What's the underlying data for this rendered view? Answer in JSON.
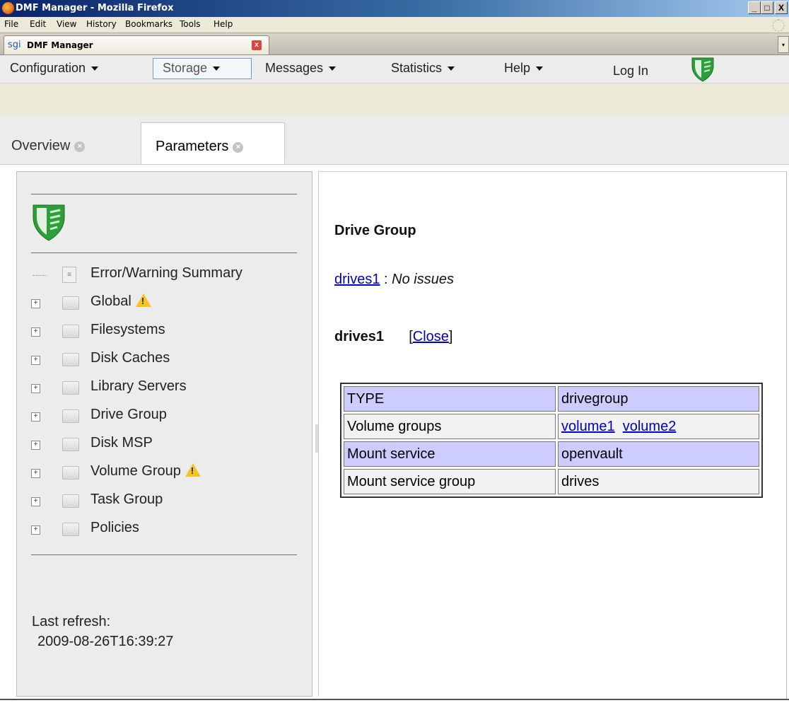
{
  "window": {
    "title": "DMF Manager - Mozilla Firefox",
    "buttons": [
      "_",
      "□",
      "X"
    ]
  },
  "browser_menu": [
    "File",
    "Edit",
    "View",
    "History",
    "Bookmarks",
    "Tools",
    "Help"
  ],
  "browser_tab": {
    "icon_text": "sgi",
    "title": "DMF Manager",
    "close_symbol": "x"
  },
  "app_nav": {
    "items": [
      "Configuration",
      "Storage",
      "Messages",
      "Statistics",
      "Help"
    ],
    "active": "Storage",
    "login": "Log In"
  },
  "content_tabs": [
    "Overview",
    "Parameters"
  ],
  "active_content_tab": "Parameters",
  "tree": {
    "items": [
      {
        "label": "Error/Warning Summary",
        "type": "doc",
        "warning": false
      },
      {
        "label": "Global",
        "type": "folder",
        "warning": true
      },
      {
        "label": "Filesystems",
        "type": "folder",
        "warning": false
      },
      {
        "label": "Disk Caches",
        "type": "folder",
        "warning": false
      },
      {
        "label": "Library Servers",
        "type": "folder",
        "warning": false
      },
      {
        "label": "Drive Group",
        "type": "folder",
        "warning": false
      },
      {
        "label": "Disk MSP",
        "type": "folder",
        "warning": false
      },
      {
        "label": "Volume Group",
        "type": "folder",
        "warning": true
      },
      {
        "label": "Task Group",
        "type": "folder",
        "warning": false
      },
      {
        "label": "Policies",
        "type": "folder",
        "warning": false
      }
    ],
    "expander": "+"
  },
  "refresh": {
    "label": "Last refresh:",
    "timestamp": "2009-08-26T16:39:27"
  },
  "main": {
    "heading": "Drive Group",
    "issue_link": "drives1",
    "issue_sep": " : ",
    "issue_text": "No issues",
    "detail_name": "drives1",
    "close_open": "[",
    "close_label": "Close",
    "close_close": "]",
    "table": [
      {
        "key": "TYPE",
        "value": "drivegroup",
        "links": [],
        "highlight": true
      },
      {
        "key": "Volume groups",
        "value": "",
        "links": [
          "volume1",
          "volume2"
        ],
        "highlight": false
      },
      {
        "key": "Mount service",
        "value": "openvault",
        "links": [],
        "highlight": true
      },
      {
        "key": "Mount service group",
        "value": "drives",
        "links": [],
        "highlight": false
      }
    ]
  },
  "colors": {
    "highlight_row": "#ccccff",
    "link": "#0000cc",
    "shield_green": "#2e9e3a"
  }
}
